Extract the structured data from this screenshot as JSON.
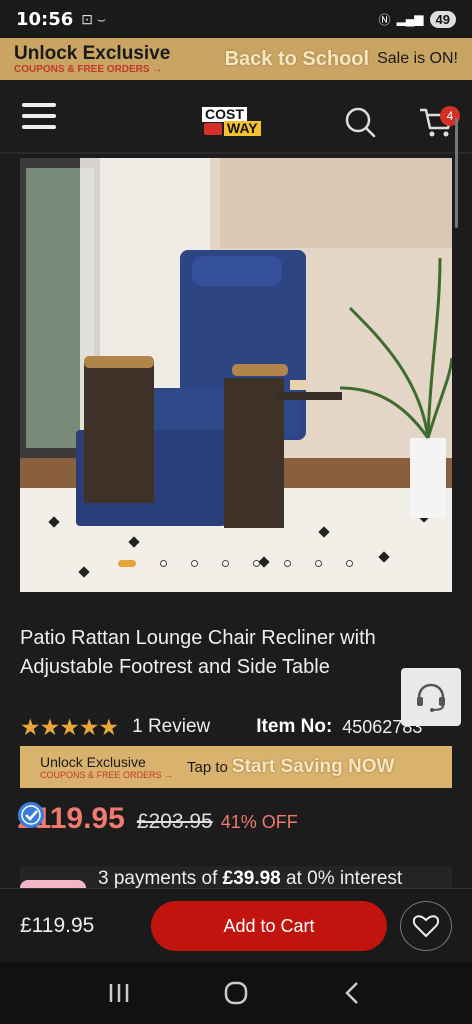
{
  "status_bar": {
    "time": "10:56",
    "battery": "49"
  },
  "promo_banner": {
    "title": "Unlock Exclusive",
    "subtitle": "COUPONS & FREE ORDERS →",
    "highlight": "Back to School",
    "tail": "Sale is ON!"
  },
  "header": {
    "logo_top": "COST",
    "logo_bottom": "WAY",
    "cart_count": "4"
  },
  "gallery": {
    "total_images": 8,
    "active_index": 0
  },
  "product": {
    "title": "Patio Rattan Lounge Chair Recliner with Adjustable Footrest and Side Table",
    "stars": "★★★★★",
    "review_count": "1  Review",
    "item_no_label": "Item No:",
    "item_no_value": "45062783"
  },
  "promo_strip": {
    "title": "Unlock Exclusive",
    "subtitle": "COUPONS & FREE ORDERS →",
    "tap": "Tap to",
    "highlight": "Start Saving NOW"
  },
  "price": {
    "current": "£119.95",
    "original": "£203.95",
    "discount": "41% OFF"
  },
  "installments": {
    "prefix": "3 payments of ",
    "amount": "£39.98",
    "suffix": " at 0% interest"
  },
  "bottom_bar": {
    "price": "£119.95",
    "add_to_cart": "Add to Cart"
  },
  "colors": {
    "accent_red": "#c2140f",
    "sale_red": "#f07a6e",
    "gold": "#c9a463",
    "star": "#e7a53b"
  }
}
